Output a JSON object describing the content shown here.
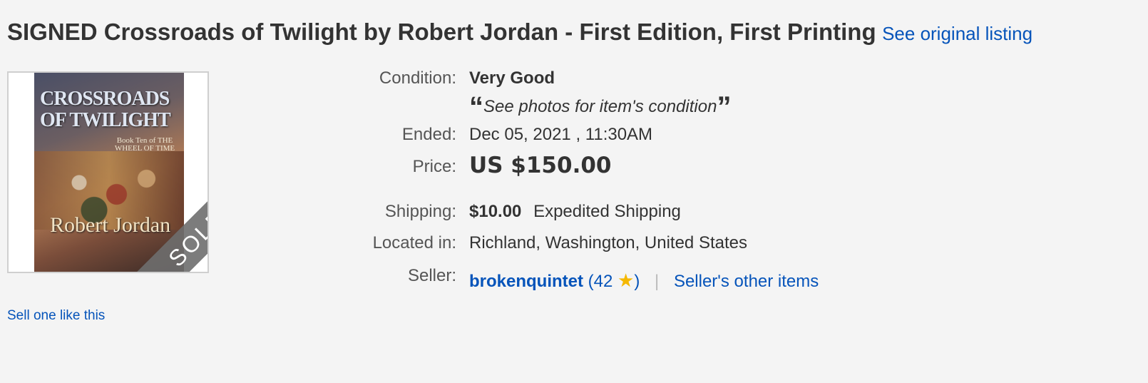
{
  "listing": {
    "title": "SIGNED Crossroads of Twilight by Robert Jordan - First Edition, First Printing",
    "see_original_label": "See original listing"
  },
  "image": {
    "cover_title": "CROSSROADS OF TWILIGHT",
    "cover_book_line": "Book Ten of THE WHEEL OF TIME",
    "cover_author": "Robert Jordan",
    "sold_badge": "SOLD"
  },
  "details": {
    "condition_label": "Condition:",
    "condition_value": "Very Good",
    "condition_note": "See photos for item's condition",
    "ended_label": "Ended:",
    "ended_value": "Dec 05, 2021 , 11:30AM",
    "price_label": "Price:",
    "price_value": "US $150.00",
    "shipping_label": "Shipping:",
    "shipping_cost": "$10.00",
    "shipping_method": "Expedited Shipping",
    "location_label": "Located in:",
    "location_value": "Richland, Washington, United States",
    "seller_label": "Seller:",
    "seller_name": "brokenquintet",
    "seller_feedback": "42",
    "seller_other_items": "Seller's other items"
  },
  "sell_one_like_this": "Sell one like this",
  "colors": {
    "link": "#0654ba",
    "star": "#f5b800",
    "background": "#f4f4f4"
  }
}
